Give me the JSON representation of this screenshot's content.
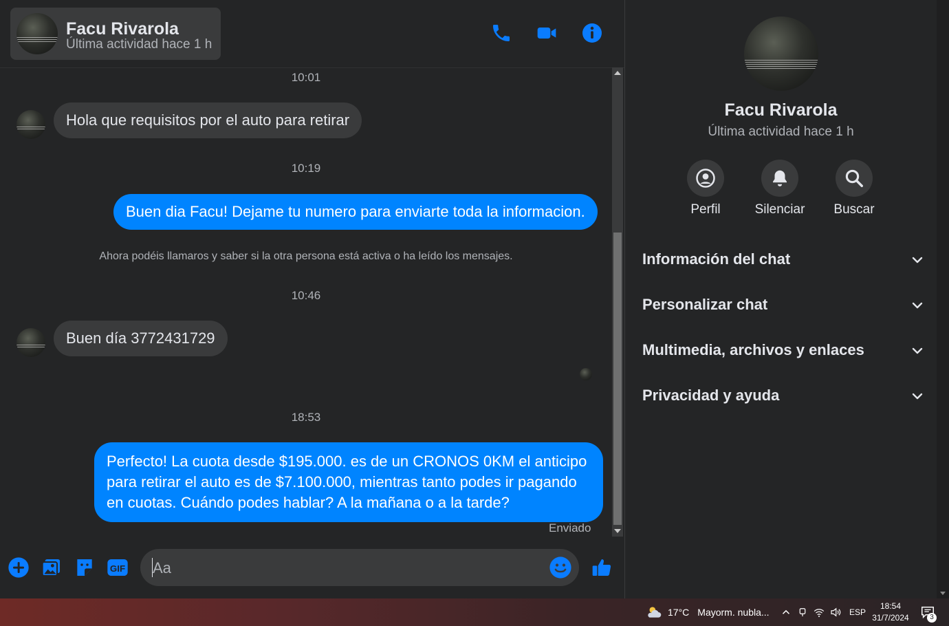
{
  "colors": {
    "accent": "#0084ff",
    "bubble_in": "#3a3b3c",
    "background": "#242526"
  },
  "chat": {
    "contact_name": "Facu Rivarola",
    "contact_status": "Última actividad hace 1 h",
    "header_icons": [
      "phone-icon",
      "video-camera-icon",
      "info-icon"
    ],
    "messages": [
      {
        "type": "timestamp",
        "text": "10:01"
      },
      {
        "type": "incoming",
        "text": "Hola que requisitos por el auto para retirar"
      },
      {
        "type": "timestamp",
        "text": "10:19"
      },
      {
        "type": "outgoing",
        "text": "Buen dia Facu! Dejame tu numero para enviarte toda la informacion."
      },
      {
        "type": "system",
        "text": "Ahora podéis llamaros y saber si la otra persona está activa o ha leído los mensajes."
      },
      {
        "type": "timestamp",
        "text": "10:46"
      },
      {
        "type": "incoming",
        "text": "Buen día 3772431729"
      },
      {
        "type": "timestamp",
        "text": "18:53"
      },
      {
        "type": "outgoing",
        "text": "Perfecto! La cuota desde $195.000. es de un CRONOS 0KM el anticipo para retirar el auto es de $7.100.000, mientras tanto podes ir pagando en cuotas. Cuándo podes hablar? A la mañana o a la tarde?"
      }
    ],
    "sent_label": "Enviado",
    "composer": {
      "placeholder": "Aa",
      "icons": [
        "plus-icon",
        "photo-icon",
        "sticker-icon",
        "gif-icon",
        "emoji-icon",
        "thumbs-up-icon"
      ],
      "gif_label": "GIF"
    }
  },
  "side": {
    "name": "Facu Rivarola",
    "status": "Última actividad hace 1 h",
    "actions": [
      {
        "label": "Perfil",
        "icon": "profile-icon"
      },
      {
        "label": "Silenciar",
        "icon": "bell-icon"
      },
      {
        "label": "Buscar",
        "icon": "search-icon"
      }
    ],
    "sections": [
      "Información del chat",
      "Personalizar chat",
      "Multimedia, archivos y enlaces",
      "Privacidad y ayuda"
    ]
  },
  "taskbar": {
    "temperature": "17°C",
    "weather": "Mayorm. nubla...",
    "language": "ESP",
    "time": "18:54",
    "date": "31/7/2024",
    "notification_count": "3"
  }
}
